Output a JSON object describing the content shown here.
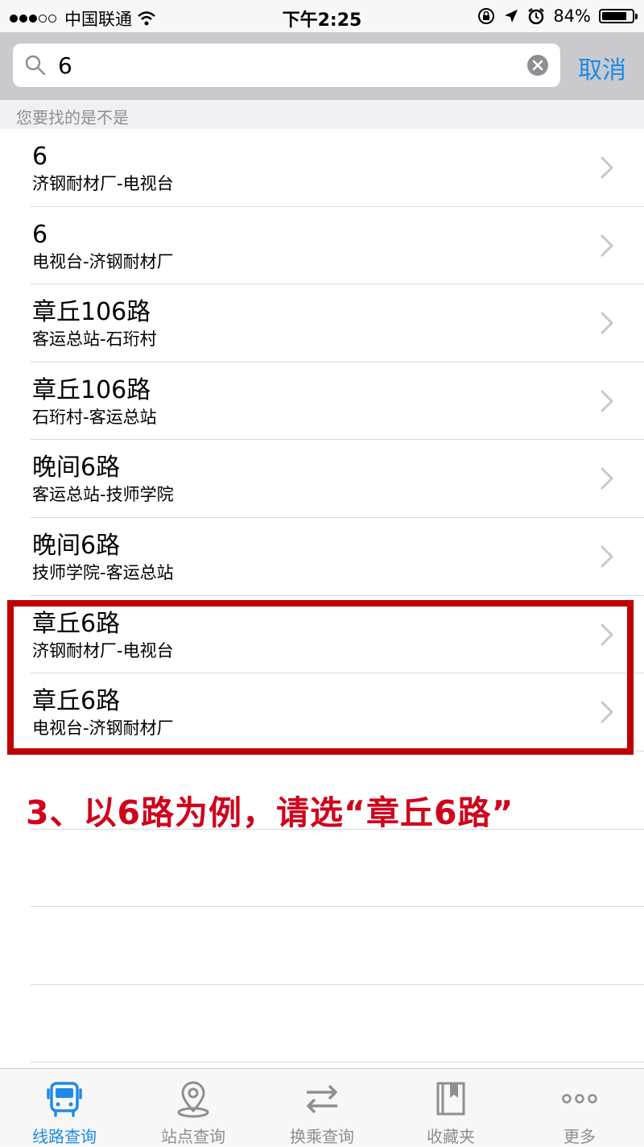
{
  "status_bar": {
    "carrier": "中国联通",
    "time": "下午2:25",
    "battery_percent": "84%",
    "battery_level": 0.84
  },
  "search": {
    "query": "6",
    "cancel_label": "取消"
  },
  "suggestion_header": "您要找的是不是",
  "routes": [
    {
      "name": "6",
      "direction": "济钢耐材厂-电视台"
    },
    {
      "name": "6",
      "direction": "电视台-济钢耐材厂"
    },
    {
      "name": "章丘106路",
      "direction": "客运总站-石珩村"
    },
    {
      "name": "章丘106路",
      "direction": "石珩村-客运总站"
    },
    {
      "name": "晚间6路",
      "direction": "客运总站-技师学院"
    },
    {
      "name": "晚间6路",
      "direction": "技师学院-客运总站"
    },
    {
      "name": "章丘6路",
      "direction": "济钢耐材厂-电视台"
    },
    {
      "name": "章丘6路",
      "direction": "电视台-济钢耐材厂"
    }
  ],
  "annotation": "3、以6路为例，请选“章丘6路”",
  "tabs": [
    {
      "label": "线路查询",
      "icon": "bus-icon",
      "active": true
    },
    {
      "label": "站点查询",
      "icon": "location-pin-icon",
      "active": false
    },
    {
      "label": "换乘查询",
      "icon": "transfer-arrows-icon",
      "active": false
    },
    {
      "label": "收藏夹",
      "icon": "bookmark-icon",
      "active": false
    },
    {
      "label": "更多",
      "icon": "more-dots-icon",
      "active": false
    }
  ],
  "colors": {
    "accent": "#1e8ae6",
    "annotation": "#d0021b",
    "highlight_border": "#c00000",
    "tab_inactive": "#8e8e93"
  }
}
